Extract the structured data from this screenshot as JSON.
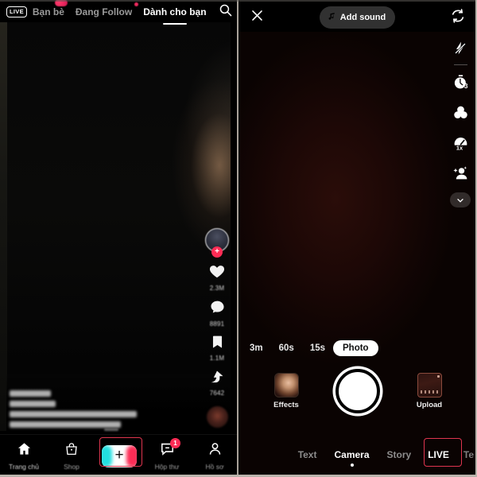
{
  "feed": {
    "live_badge": "LIVE",
    "tabs": [
      {
        "label": "Bạn bè",
        "state": "dim",
        "badge": true
      },
      {
        "label": "Đang Follow",
        "state": "dim",
        "badge_small": true
      },
      {
        "label": "Dành cho bạn",
        "state": "active"
      }
    ],
    "search_icon": "search-icon",
    "actions": {
      "avatar": "avatar",
      "follow_plus": "+",
      "like_count": "2.3M",
      "comment_count": "8891",
      "bookmark_count": "1.1M",
      "share_count": "7642"
    },
    "bottom_nav": [
      {
        "label": "Trang chủ",
        "icon": "home-icon",
        "state": "active"
      },
      {
        "label": "Shop",
        "icon": "shop-bag-icon",
        "state": "muted"
      },
      {
        "label": "",
        "icon": "create-plus-icon",
        "state": "create"
      },
      {
        "label": "Hộp thư",
        "icon": "inbox-message-icon",
        "state": "muted",
        "badge": "1"
      },
      {
        "label": "Hồ sơ",
        "icon": "profile-person-icon",
        "state": "muted"
      }
    ]
  },
  "camera": {
    "close_icon": "close-icon",
    "add_sound_label": "Add sound",
    "music_icon": "music-note-icon",
    "flip_icon": "flip-camera-icon",
    "tools": [
      {
        "name": "flash-off-icon",
        "label": ""
      },
      {
        "name": "timer-icon",
        "label": "3"
      },
      {
        "name": "filters-icon",
        "label": ""
      },
      {
        "name": "speed-icon",
        "label": "1x"
      },
      {
        "name": "enhance-icon",
        "label": ""
      },
      {
        "name": "chevron-down-icon",
        "label": ""
      }
    ],
    "durations": [
      {
        "label": "3m",
        "selected": false
      },
      {
        "label": "60s",
        "selected": false
      },
      {
        "label": "15s",
        "selected": false
      },
      {
        "label": "Photo",
        "selected": true
      }
    ],
    "effects_label": "Effects",
    "upload_label": "Upload",
    "shutter": "shutter-button",
    "modes": [
      {
        "label": "Text",
        "state": "idle"
      },
      {
        "label": "Camera",
        "state": "active"
      },
      {
        "label": "Story",
        "state": "idle"
      },
      {
        "label": "LIVE",
        "state": "highlighted"
      },
      {
        "label": "Te",
        "state": "cut"
      }
    ]
  },
  "colors": {
    "accent_pink": "#fe2c55",
    "accent_cyan": "#22dfe0",
    "highlight_box": "#e0354f",
    "selected_pill_bg": "#ffffff"
  }
}
